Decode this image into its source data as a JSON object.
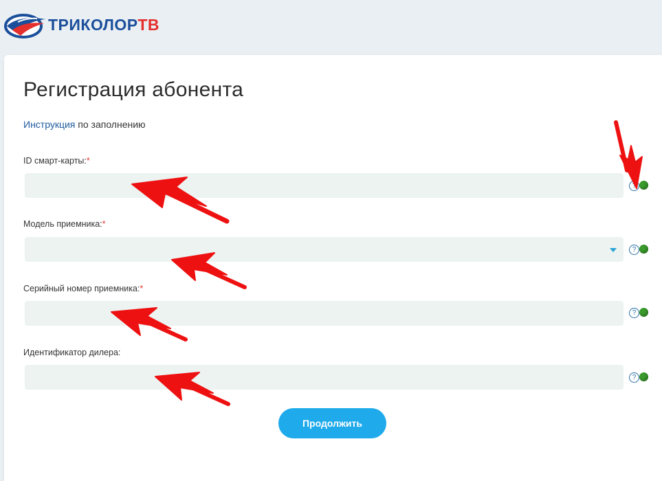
{
  "brand": {
    "name": "ТРИКОЛОР",
    "suffix": "ТВ"
  },
  "page": {
    "title": "Регистрация абонента"
  },
  "instruction": {
    "link_text": "Инструкция",
    "rest_text": " по заполнению"
  },
  "fields": [
    {
      "label": "ID смарт-карты:",
      "required": "*",
      "value": "",
      "type": "text"
    },
    {
      "label": "Модель приемника:",
      "required": "*",
      "value": "",
      "type": "select"
    },
    {
      "label": "Серийный номер приемника:",
      "required": "*",
      "value": "",
      "type": "text"
    },
    {
      "label": "Идентификатор дилера:",
      "required": "",
      "value": "",
      "type": "text"
    }
  ],
  "help_symbol": "?",
  "submit": {
    "label": "Продолжить"
  },
  "colors": {
    "accent": "#1eaaeb",
    "link": "#1e5a9e",
    "required": "#e53935",
    "status_ok": "#3a9a2c",
    "annotation_arrows": "#ee1111"
  }
}
